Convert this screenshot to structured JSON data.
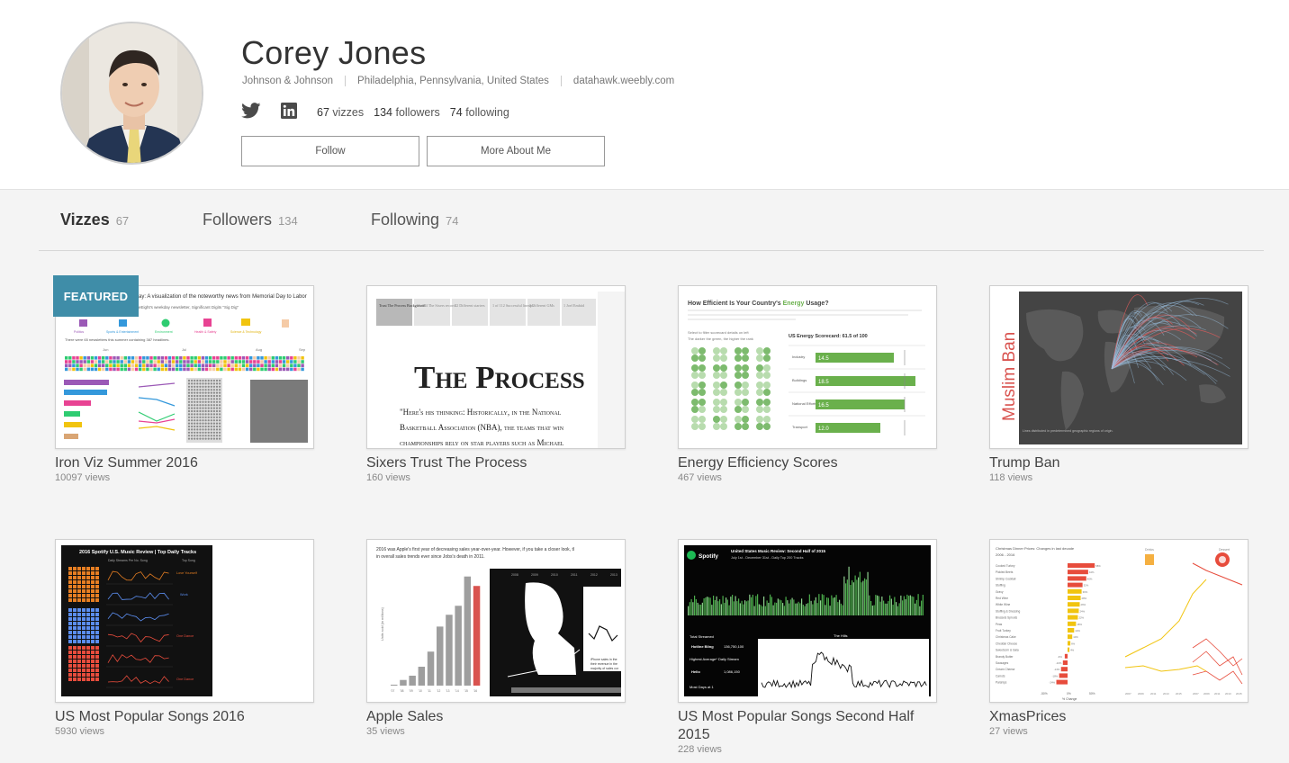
{
  "profile": {
    "name": "Corey Jones",
    "company": "Johnson & Johnson",
    "location": "Philadelphia, Pennsylvania, United States",
    "website": "datahawk.weebly.com",
    "stats": {
      "vizzes_count": "67",
      "vizzes_label": "vizzes",
      "followers_count": "134",
      "followers_label": "followers",
      "following_count": "74",
      "following_label": "following"
    },
    "social_icons": [
      "twitter-icon",
      "linkedin-icon"
    ],
    "buttons": {
      "follow": "Follow",
      "more_about": "More About Me"
    }
  },
  "tabs": [
    {
      "label": "Vizzes",
      "count": "67",
      "active": true
    },
    {
      "label": "Followers",
      "count": "134",
      "active": false
    },
    {
      "label": "Following",
      "count": "74",
      "active": false
    }
  ],
  "featured_badge": "FEATURED",
  "vizzes": [
    {
      "title": "Iron Viz Summer 2016",
      "views": "10097 views",
      "thumb_text": {
        "headline": "ay: A visualization of the noteworthy news from Memorial Day to Labor",
        "sub": "eEight's weekday newsletter, Significant Digits \"Sig Dig\"",
        "note": "There were 65 newsletters this summer containing 387 headlines.",
        "month_jun": "Jun",
        "month_jul": "Jul",
        "month_aug": "Aug",
        "month_sep": "Sep",
        "cat_politics": "Politics",
        "cat_sports": "Sports & Entertainment",
        "cat_environment": "Environment",
        "cat_health": "Health & Safety",
        "cat_science": "Science & Technology"
      }
    },
    {
      "title": "Sixers Trust The Process",
      "views": "160 views",
      "thumb_text": {
        "tab1": "Trust The Process Background",
        "tab2": "66-234 The Sixers record",
        "tab3": "42 Different starters",
        "tab4": "1 of 112 Successful lineups",
        "tab5": "3 Different GMs",
        "tab6": "1 Joel Embiid",
        "heading": "The Process",
        "quote1": "\"Here's his thinking: Historically, in the National",
        "quote2": "Basketball Association (NBA), the teams that win",
        "quote3": "championships rely on star players such as Michael"
      }
    },
    {
      "title": "Energy Efficiency Scores",
      "views": "467 views",
      "thumb_text": {
        "heading_prefix": "How Efficient Is Your Country's ",
        "heading_energy": "Energy",
        "heading_suffix": " Usage?",
        "scorecard": "US Energy Scorecard: 61.5 of 100",
        "select_hint": "Select to filter scorecard details on left",
        "hover_hint": "The darker the green, the higher the rank"
      },
      "chart_data": {
        "type": "bar",
        "categories": [
          "Industry",
          "Buildings",
          "National Efforts",
          "Transport"
        ],
        "values": [
          14.5,
          18.5,
          16.5,
          12.0
        ],
        "labels": [
          "14.5",
          "18.5",
          "16.5",
          "12.0"
        ]
      }
    },
    {
      "title": "Trump Ban",
      "views": "118 views",
      "thumb_text": {
        "vertical": "Muslim Ban",
        "caption": "Lines distributed in predetermined geographic regions of origin."
      }
    },
    {
      "title": "US Most Popular Songs 2016",
      "views": "5930 views",
      "thumb_text": {
        "heading": "2016 Spotify U.S. Music Review | Top Daily Tracks",
        "col1": "Daily Streams Per No. Song",
        "col2": "Top Song",
        "song1": "Love Yourself",
        "song2": "Work",
        "song3": "One Dance",
        "song4": "One Dance"
      }
    },
    {
      "title": "Apple Sales",
      "views": "35 views",
      "thumb_text": {
        "intro1": "2016 was Apple's first year of decreasing sales year-over-year. However, if you take a closer look, tl",
        "intro2": "in overall sales trends ever since Jobs's death in 2011.",
        "ylabel": "Units sold (in millions)",
        "years": [
          "'07",
          "'08",
          "'09",
          "'10",
          "'11",
          "'12",
          "'13",
          "'14",
          "'15",
          "'16"
        ],
        "photo_years": [
          "2008",
          "2009",
          "2010",
          "2011",
          "2012",
          "2013"
        ],
        "photo_note1": "iPhone sales in the",
        "photo_note2": "their revenue in the",
        "photo_note3": "majority of sales cor"
      },
      "chart_data": {
        "type": "bar",
        "categories": [
          "'07",
          "'08",
          "'09",
          "'10",
          "'11",
          "'12",
          "'13",
          "'14",
          "'15",
          "'16"
        ],
        "values": [
          2,
          12,
          21,
          40,
          72,
          125,
          150,
          169,
          231,
          211
        ],
        "highlight": "'16",
        "colors": {
          "bar": "#9e9e9e",
          "highlight": "#d9534f"
        }
      }
    },
    {
      "title": "US Most Popular Songs Second Half 2015",
      "views": "228 views",
      "thumb_text": {
        "brand": "Spotify",
        "heading": "United States Music Review: Second Half of 2015",
        "sub": "July 1st - December 31st - Daily Top 200 Tracks",
        "hills": "The Hills",
        "total": "Total Streamed",
        "hotline": "Hotline Bling",
        "hotline_value": "136,750,100",
        "highest": "Highest Average* Daily Stream",
        "hello": "Hello",
        "hello_value": "1,086,150",
        "most_days": "Most Days at 1"
      }
    },
    {
      "title": "XmasPrices",
      "views": "27 views",
      "thumb_text": {
        "heading": "Christmas Dinner Prices: Changes in last decade",
        "range": "2006 - 2016",
        "items": [
          "Cooked Turkey",
          "Pickled Beets",
          "Shrimp Cocktail",
          "Stuffing",
          "Gravy",
          "Red Wine",
          "White Wine",
          "Stuffing & Dressing",
          "Brussels Sprouts",
          "Peas",
          "Fruit Turkey",
          "Christmas Cake",
          "Cheddar Cheese",
          "Sweetcorn & Gala",
          "Brandy Butter",
          "Sausages",
          "Cream Cheese",
          "Carrots",
          "Parsnips"
        ],
        "xlabel": "% Change",
        "ax_neg": "-50%",
        "ax_zero": "0%",
        "ax_pos": "50%",
        "label_drinks": "Drinks",
        "label_dessert": "Dessert",
        "year_labels": [
          "2007",
          "2009",
          "2011",
          "2013",
          "2015"
        ]
      },
      "chart_data": {
        "type": "bar",
        "categories": [
          "Cooked Turkey",
          "Pickled Beets",
          "Shrimp Cocktail",
          "Stuffing",
          "Gravy",
          "Red Wine",
          "White Wine",
          "Stuffing & Dressing",
          "Brussels Sprouts",
          "Peas",
          "Fruit Turkey",
          "Christmas Cake",
          "Cheddar Cheese",
          "Sweetcorn & Gala",
          "Brandy Butter",
          "Sausages",
          "Cream Cheese",
          "Carrots",
          "Parsnips"
        ],
        "values": [
          58,
          44,
          40,
          32,
          30,
          28,
          26,
          24,
          22,
          18,
          14,
          10,
          6,
          4,
          -6,
          -10,
          -14,
          -18,
          -24
        ],
        "labels": [
          "58%",
          "44%",
          "40%",
          "32%",
          "30%",
          "28%",
          "26%",
          "24%",
          "22%",
          "18%",
          "14%",
          "10%",
          "6%",
          "4%",
          "-6%",
          "-10%",
          "-14%",
          "-18%",
          "-24%"
        ]
      }
    }
  ],
  "colors": {
    "accent": "#3f8da8",
    "green": "#6ab04c",
    "red": "#d9534f",
    "spotify_green": "#1db954"
  }
}
